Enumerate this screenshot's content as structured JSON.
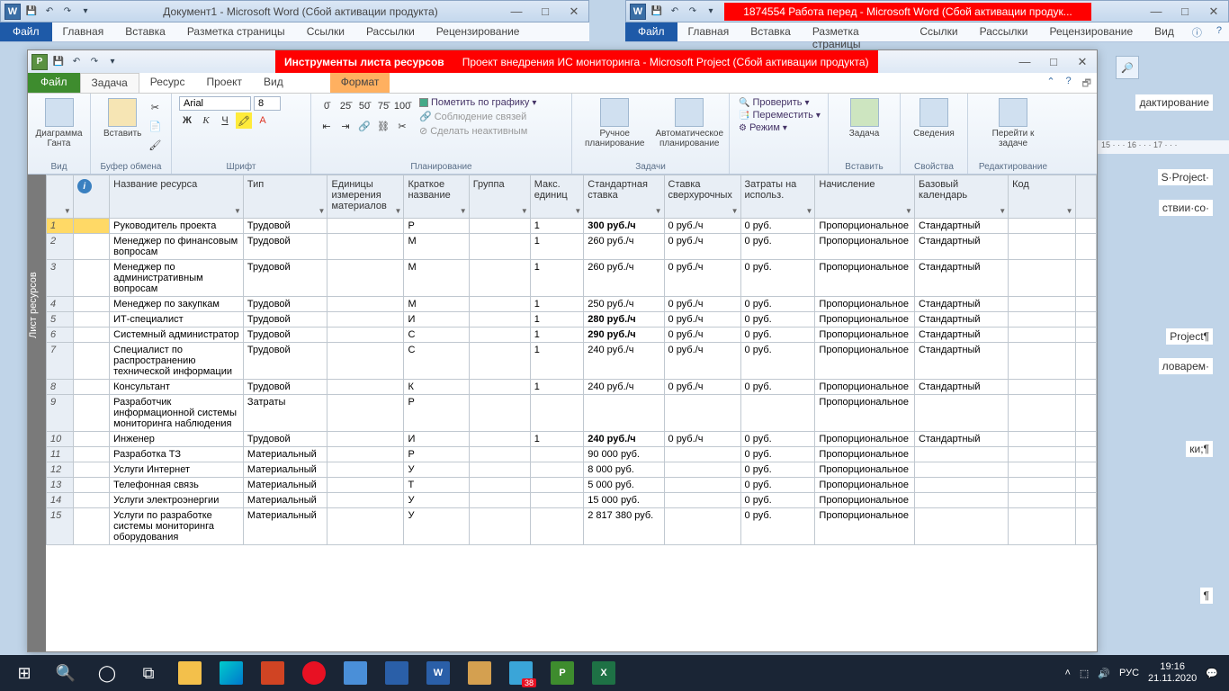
{
  "word_left": {
    "title": "Документ1 - Microsoft Word (Сбой активации продукта)",
    "tabs": [
      "Главная",
      "Вставка",
      "Разметка страницы",
      "Ссылки",
      "Рассылки",
      "Рецензирование"
    ]
  },
  "word_right": {
    "title": "1874554 Работа перед - Microsoft Word (Сбой активации продук...",
    "tabs": [
      "Главная",
      "Вставка",
      "Разметка страницы",
      "Ссылки",
      "Рассылки",
      "Рецензирование",
      "Вид"
    ]
  },
  "file_label": "Файл",
  "project": {
    "tool_context": "Инструменты листа ресурсов",
    "doc_title": "Проект внедрения ИС мониторинга - Microsoft Project (Сбой активации продукта)",
    "tabs": {
      "zadacha": "Задача",
      "resurs": "Ресурс",
      "proekt": "Проект",
      "vid": "Вид",
      "format": "Формат"
    },
    "ribbon": {
      "view": {
        "big": "Диаграмма Ганта",
        "group": "Вид"
      },
      "clip": {
        "big": "Вставить",
        "group": "Буфер обмена"
      },
      "font": {
        "name": "Arial",
        "size": "8",
        "group": "Шрифт"
      },
      "plan": {
        "mark": "Пометить по графику",
        "links": "Соблюдение связей",
        "inactive": "Сделать неактивным",
        "group": "Планирование"
      },
      "sched": {
        "manual": "Ручное планирование",
        "auto": "Автоматическое планирование",
        "group": "Задачи"
      },
      "tasks": {
        "check": "Проверить",
        "move": "Переместить",
        "mode": "Режим"
      },
      "insert": {
        "big": "Задача",
        "group": "Вставить"
      },
      "props": {
        "big": "Сведения",
        "group": "Свойства"
      },
      "goto": {
        "big": "Перейти к задаче",
        "group": "Редактирование"
      }
    },
    "view_strip": "Лист ресурсов",
    "columns": [
      "",
      "",
      "Название ресурса",
      "Тип",
      "Единицы измерения материалов",
      "Краткое название",
      "Группа",
      "Макс. единиц",
      "Стандартная ставка",
      "Ставка сверхурочных",
      "Затраты на использ.",
      "Начисление",
      "Базовый календарь",
      "Код"
    ],
    "rows": [
      {
        "n": "1",
        "name": "Руководитель проекта",
        "type": "Трудовой",
        "unit": "",
        "short": "Р",
        "grp": "",
        "max": "1",
        "rate": "300 руб./ч",
        "rb": true,
        "over": "0 руб./ч",
        "cost": "0 руб.",
        "acc": "Пропорциональное",
        "cal": "Стандартный"
      },
      {
        "n": "2",
        "name": "Менеджер по финансовым вопросам",
        "type": "Трудовой",
        "unit": "",
        "short": "М",
        "grp": "",
        "max": "1",
        "rate": "260 руб./ч",
        "over": "0 руб./ч",
        "cost": "0 руб.",
        "acc": "Пропорциональное",
        "cal": "Стандартный"
      },
      {
        "n": "3",
        "name": "Менеджер по административным вопросам",
        "type": "Трудовой",
        "unit": "",
        "short": "М",
        "grp": "",
        "max": "1",
        "rate": "260 руб./ч",
        "over": "0 руб./ч",
        "cost": "0 руб.",
        "acc": "Пропорциональное",
        "cal": "Стандартный"
      },
      {
        "n": "4",
        "name": "Менеджер по закупкам",
        "type": "Трудовой",
        "unit": "",
        "short": "М",
        "grp": "",
        "max": "1",
        "rate": "250 руб./ч",
        "over": "0 руб./ч",
        "cost": "0 руб.",
        "acc": "Пропорциональное",
        "cal": "Стандартный"
      },
      {
        "n": "5",
        "name": "ИТ-специалист",
        "type": "Трудовой",
        "unit": "",
        "short": "И",
        "grp": "",
        "max": "1",
        "rate": "280 руб./ч",
        "rb": true,
        "over": "0 руб./ч",
        "cost": "0 руб.",
        "acc": "Пропорциональное",
        "cal": "Стандартный"
      },
      {
        "n": "6",
        "name": "Системный администратор",
        "type": "Трудовой",
        "unit": "",
        "short": "С",
        "grp": "",
        "max": "1",
        "rate": "290 руб./ч",
        "rb": true,
        "over": "0 руб./ч",
        "cost": "0 руб.",
        "acc": "Пропорциональное",
        "cal": "Стандартный"
      },
      {
        "n": "7",
        "name": "Специалист по распространению технической информации",
        "type": "Трудовой",
        "unit": "",
        "short": "С",
        "grp": "",
        "max": "1",
        "rate": "240 руб./ч",
        "over": "0 руб./ч",
        "cost": "0 руб.",
        "acc": "Пропорциональное",
        "cal": "Стандартный"
      },
      {
        "n": "8",
        "name": "Консультант",
        "type": "Трудовой",
        "unit": "",
        "short": "К",
        "grp": "",
        "max": "1",
        "rate": "240 руб./ч",
        "over": "0 руб./ч",
        "cost": "0 руб.",
        "acc": "Пропорциональное",
        "cal": "Стандартный"
      },
      {
        "n": "9",
        "name": "Разработчик информационной системы мониторинга наблюдения",
        "type": "Затраты",
        "unit": "",
        "short": "Р",
        "grp": "",
        "max": "",
        "rate": "",
        "over": "",
        "cost": "",
        "acc": "Пропорциональное",
        "cal": ""
      },
      {
        "n": "10",
        "name": "Инженер",
        "type": "Трудовой",
        "unit": "",
        "short": "И",
        "grp": "",
        "max": "1",
        "rate": "240 руб./ч",
        "rb": true,
        "over": "0 руб./ч",
        "cost": "0 руб.",
        "acc": "Пропорциональное",
        "cal": "Стандартный"
      },
      {
        "n": "11",
        "name": "Разработка ТЗ",
        "type": "Материальный",
        "unit": "",
        "short": "Р",
        "grp": "",
        "max": "",
        "rate": "90 000 руб.",
        "over": "",
        "cost": "0 руб.",
        "acc": "Пропорциональное",
        "cal": ""
      },
      {
        "n": "12",
        "name": "Услуги Интернет",
        "type": "Материальный",
        "unit": "",
        "short": "У",
        "grp": "",
        "max": "",
        "rate": "8 000 руб.",
        "over": "",
        "cost": "0 руб.",
        "acc": "Пропорциональное",
        "cal": ""
      },
      {
        "n": "13",
        "name": "Телефонная связь",
        "type": "Материальный",
        "unit": "",
        "short": "Т",
        "grp": "",
        "max": "",
        "rate": "5 000 руб.",
        "over": "",
        "cost": "0 руб.",
        "acc": "Пропорциональное",
        "cal": ""
      },
      {
        "n": "14",
        "name": "Услуги электроэнергии",
        "type": "Материальный",
        "unit": "",
        "short": "У",
        "grp": "",
        "max": "",
        "rate": "15 000 руб.",
        "over": "",
        "cost": "0 руб.",
        "acc": "Пропорциональное",
        "cal": ""
      },
      {
        "n": "15",
        "name": "Услуги по разработке системы мониторинга оборудования",
        "type": "Материальный",
        "unit": "",
        "short": "У",
        "grp": "",
        "max": "",
        "rate": "2 817 380 руб.",
        "over": "",
        "cost": "0 руб.",
        "acc": "Пропорциональное",
        "cal": ""
      }
    ]
  },
  "peek": {
    "ruler": "15 · · · 16 · · · 17 · · ·",
    "t1": "S·Project·",
    "t2": "ствии·со·",
    "t3": "Project¶",
    "t4": "ловарем·",
    "t5": "ки;¶",
    "t6": "¶",
    "edit": "дактирование"
  },
  "taskbar": {
    "time": "19:16",
    "date": "21.11.2020",
    "lang": "РУС",
    "badge": "38"
  }
}
